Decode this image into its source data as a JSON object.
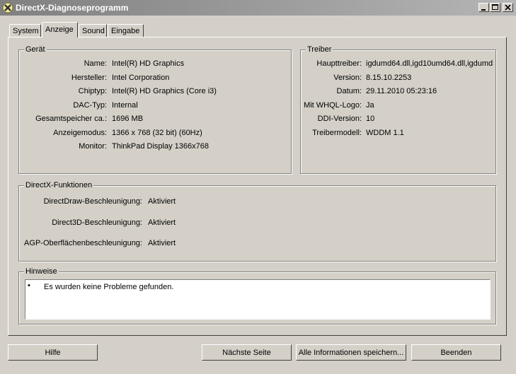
{
  "window": {
    "title": "DirectX-Diagnoseprogramm"
  },
  "tabs": [
    {
      "label": "System"
    },
    {
      "label": "Anzeige"
    },
    {
      "label": "Sound"
    },
    {
      "label": "Eingabe"
    }
  ],
  "device": {
    "title": "Gerät",
    "rows": [
      {
        "label": "Name:",
        "value": "Intel(R) HD Graphics"
      },
      {
        "label": "Hersteller:",
        "value": "Intel Corporation"
      },
      {
        "label": "Chiptyp:",
        "value": "Intel(R) HD Graphics (Core i3)"
      },
      {
        "label": "DAC-Typ:",
        "value": "Internal"
      },
      {
        "label": "Gesamtspeicher ca.:",
        "value": "1696 MB"
      },
      {
        "label": "Anzeigemodus:",
        "value": "1366 x 768 (32 bit) (60Hz)"
      },
      {
        "label": "Monitor:",
        "value": "ThinkPad Display 1366x768"
      }
    ]
  },
  "driver": {
    "title": "Treiber",
    "rows": [
      {
        "label": "Haupttreiber:",
        "value": "igdumd64.dll,igd10umd64.dll,igdumd›"
      },
      {
        "label": "Version:",
        "value": "8.15.10.2253"
      },
      {
        "label": "Datum:",
        "value": "29.11.2010 05:23:16"
      },
      {
        "label": "Mit WHQL-Logo:",
        "value": "Ja"
      },
      {
        "label": "DDI-Version:",
        "value": "10"
      },
      {
        "label": "Treibermodell:",
        "value": "WDDM 1.1"
      }
    ]
  },
  "features": {
    "title": "DirectX-Funktionen",
    "rows": [
      {
        "label": "DirectDraw-Beschleunigung:",
        "value": "Aktiviert"
      },
      {
        "label": "Direct3D-Beschleunigung:",
        "value": "Aktiviert"
      },
      {
        "label": "AGP-Oberflächenbeschleunigung:",
        "value": "Aktiviert"
      }
    ]
  },
  "notes": {
    "title": "Hinweise",
    "items": [
      "Es wurden keine Probleme gefunden."
    ]
  },
  "buttons": {
    "help": "Hilfe",
    "next_page": "Nächste Seite",
    "save_all": "Alle Informationen speichern...",
    "exit": "Beenden"
  }
}
